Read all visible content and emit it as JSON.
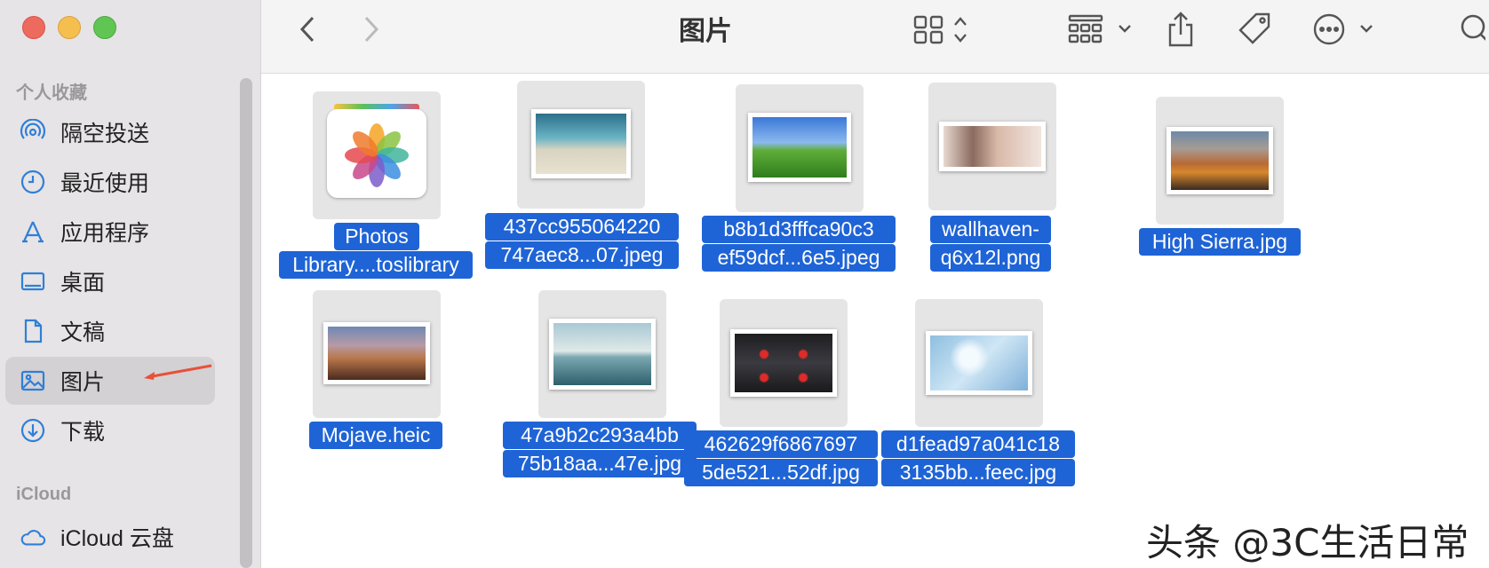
{
  "window": {
    "title": "图片"
  },
  "sidebar": {
    "favorites_label": "个人收藏",
    "items": [
      {
        "label": "隔空投送",
        "icon": "airdrop-icon"
      },
      {
        "label": "最近使用",
        "icon": "clock-icon"
      },
      {
        "label": "应用程序",
        "icon": "applications-icon"
      },
      {
        "label": "桌面",
        "icon": "desktop-icon"
      },
      {
        "label": "文稿",
        "icon": "document-icon"
      },
      {
        "label": "图片",
        "icon": "pictures-icon",
        "selected": true
      },
      {
        "label": "下载",
        "icon": "download-icon"
      }
    ],
    "icloud_label": "iCloud",
    "icloud_items": [
      {
        "label": "iCloud 云盘",
        "icon": "cloud-icon"
      }
    ]
  },
  "toolbar": {
    "icons": [
      "back-icon",
      "forward-icon",
      "view-grid-icon",
      "group-icon",
      "share-icon",
      "tag-icon",
      "more-icon",
      "search-icon"
    ]
  },
  "files": [
    {
      "line1": "Photos",
      "line2": "Library....toslibrary",
      "kind": "photos-library"
    },
    {
      "line1": "437cc955064220",
      "line2": "747aec8...07.jpeg",
      "kind": "beach"
    },
    {
      "line1": "b8b1d3fffca90c3",
      "line2": "ef59dcf...6e5.jpeg",
      "kind": "bliss"
    },
    {
      "line1": "wallhaven-",
      "line2": "q6x12l.png",
      "kind": "anime"
    },
    {
      "line1": "High Sierra.jpg",
      "line2": "",
      "kind": "sierra"
    },
    {
      "line1": "Mojave.heic",
      "line2": "",
      "kind": "mojave"
    },
    {
      "line1": "47a9b2c293a4bb",
      "line2": "75b18aa...47e.jpg",
      "kind": "lake"
    },
    {
      "line1": "462629f6867697",
      "line2": "5de521...52df.jpg",
      "kind": "eyes"
    },
    {
      "line1": "d1fead97a041c18",
      "line2": "3135bb...feec.jpg",
      "kind": "rose"
    }
  ],
  "watermark": "头条 @3C生活日常",
  "colors": {
    "selection": "#1f64d6",
    "sidebar_bg": "#e6e4e6",
    "arrow": "#e8503a"
  }
}
